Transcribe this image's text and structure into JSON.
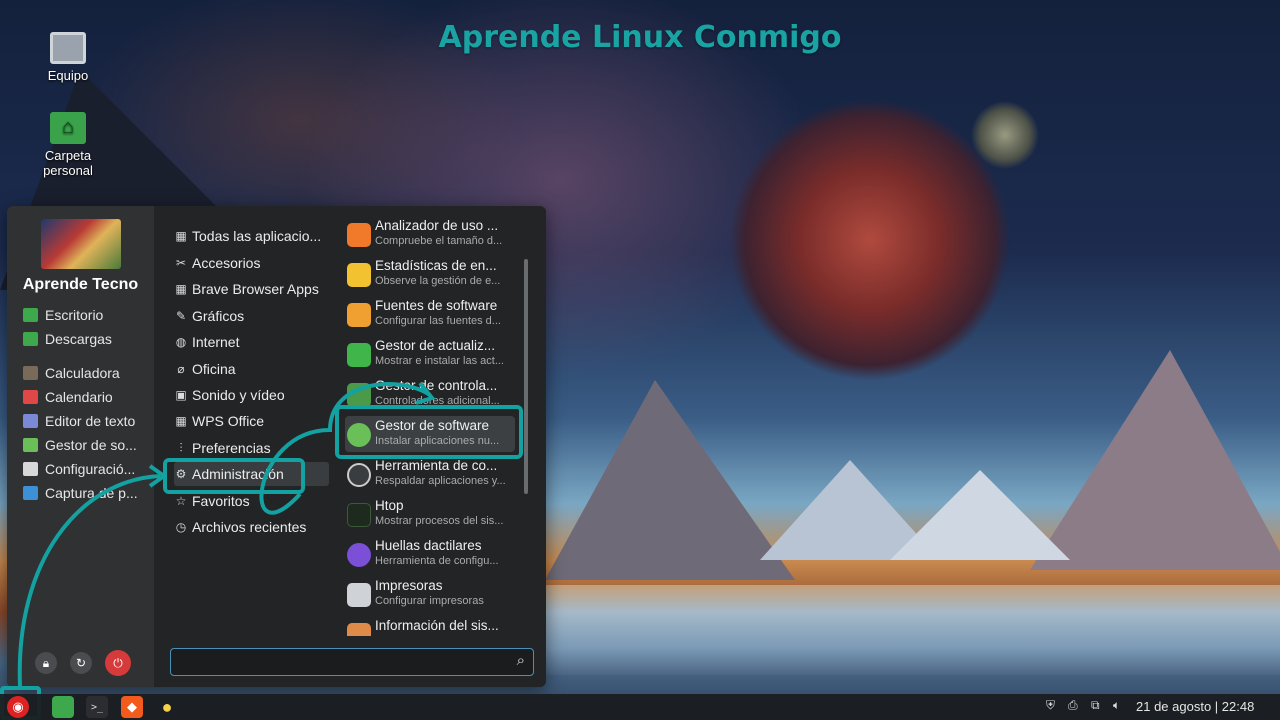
{
  "headline": "Aprende Linux Conmigo",
  "desktop_icons": [
    {
      "label": "Equipo",
      "icon": "computer-icon"
    },
    {
      "label": "Carpeta\npersonal",
      "icon": "home-folder-icon"
    }
  ],
  "menu": {
    "username": "Aprende Tecno",
    "places": [
      {
        "label": "Escritorio",
        "icon": "desktop-folder-icon",
        "color": "#3ea94c"
      },
      {
        "label": "Descargas",
        "icon": "downloads-folder-icon",
        "color": "#3ea94c"
      },
      {
        "label": "Calculadora",
        "icon": "calculator-icon",
        "color": "#7a6a5a"
      },
      {
        "label": "Calendario",
        "icon": "calendar-icon",
        "color": "#e04848"
      },
      {
        "label": "Editor de texto",
        "icon": "text-editor-icon",
        "color": "#7b8ad6"
      },
      {
        "label": "Gestor de so...",
        "icon": "software-manager-icon",
        "color": "#6bbf59"
      },
      {
        "label": "Configuració...",
        "icon": "settings-icon",
        "color": "#d8d8d8"
      },
      {
        "label": "Captura de p...",
        "icon": "screenshot-icon",
        "color": "#3d8fd6"
      }
    ],
    "categories": [
      {
        "label": "Todas las aplicacio...",
        "icon": "grid-icon"
      },
      {
        "label": "Accesorios",
        "icon": "tools-icon"
      },
      {
        "label": "Brave Browser Apps",
        "icon": "grid-icon"
      },
      {
        "label": "Gráficos",
        "icon": "brush-icon"
      },
      {
        "label": "Internet",
        "icon": "globe-icon"
      },
      {
        "label": "Oficina",
        "icon": "paperclip-icon"
      },
      {
        "label": "Sonido y vídeo",
        "icon": "media-icon"
      },
      {
        "label": "WPS Office",
        "icon": "grid-icon"
      },
      {
        "label": "Preferencias",
        "icon": "sliders-icon"
      },
      {
        "label": "Administración",
        "icon": "gear-icon"
      },
      {
        "label": "Favoritos",
        "icon": "star-icon"
      },
      {
        "label": "Archivos recientes",
        "icon": "history-icon"
      }
    ],
    "selected_category": "Administración",
    "apps": [
      {
        "name": "Analizador de uso ...",
        "desc": "Compruebe el tamaño d...",
        "icon": "disk-usage-icon",
        "color": "#f07a2a"
      },
      {
        "name": "Estadísticas de en...",
        "desc": "Observe la gestión de e...",
        "icon": "power-stats-icon",
        "color": "#f2c230"
      },
      {
        "name": "Fuentes de software",
        "desc": "Configurar las fuentes d...",
        "icon": "software-sources-icon",
        "color": "#f0a030"
      },
      {
        "name": "Gestor de actualiz...",
        "desc": "Mostrar e instalar las act...",
        "icon": "update-manager-icon",
        "color": "#3fb54a"
      },
      {
        "name": "Gestor de controla...",
        "desc": "Controladores adicional...",
        "icon": "driver-manager-icon",
        "color": "#4a9a4a"
      },
      {
        "name": "Gestor de software",
        "desc": "Instalar aplicaciones nu...",
        "icon": "software-manager-icon",
        "color": "#6bbf59"
      },
      {
        "name": "Herramienta de co...",
        "desc": "Respaldar aplicaciones y...",
        "icon": "backup-tool-icon",
        "color": "#3a3d40"
      },
      {
        "name": "Htop",
        "desc": "Mostrar procesos del sis...",
        "icon": "htop-icon",
        "color": "#1e2a1e"
      },
      {
        "name": "Huellas dactilares",
        "desc": "Herramienta de configu...",
        "icon": "fingerprint-icon",
        "color": "#7b4fd6"
      },
      {
        "name": "Impresoras",
        "desc": "Configurar impresoras",
        "icon": "printer-icon",
        "color": "#cfd2d6"
      },
      {
        "name": "Información del sis...",
        "desc": "",
        "icon": "system-info-icon",
        "color": "#e08a4a"
      }
    ],
    "selected_app": "Gestor de software",
    "search_value": ""
  },
  "taskbar": {
    "apps": [
      {
        "name": "menu",
        "icon": "linuxmint-menu-icon"
      },
      {
        "name": "files",
        "icon": "folder-icon"
      },
      {
        "name": "terminal",
        "icon": "terminal-icon"
      },
      {
        "name": "brave",
        "icon": "brave-icon"
      },
      {
        "name": "idea",
        "icon": "lightbulb-icon"
      }
    ],
    "clock": "21 de agosto | 22:48"
  },
  "colors": {
    "accent": "#14a1a1",
    "menu_bg": "#222426",
    "sidebar_bg": "#2f3133"
  }
}
